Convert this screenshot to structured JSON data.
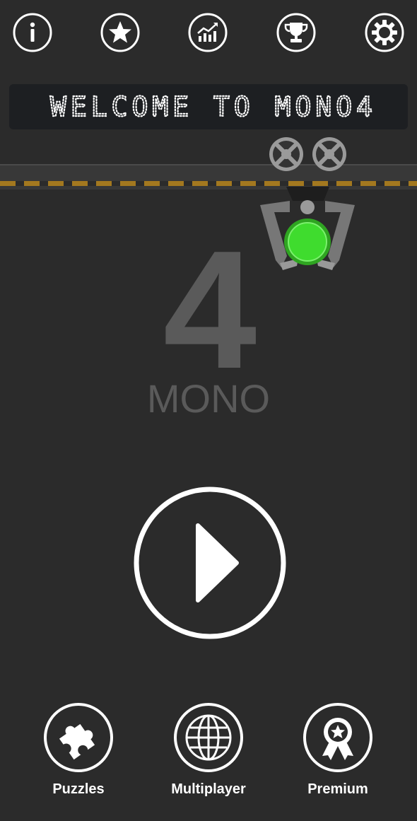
{
  "top_bar": {
    "icons": [
      "info-icon",
      "star-icon",
      "stats-chart-icon",
      "trophy-icon",
      "settings-gear-icon"
    ]
  },
  "banner": {
    "text": "WELCOME TO MONO4",
    "led_color": "#ffffff"
  },
  "logo": {
    "number": "4",
    "word": "MONO",
    "token_color": "#3fdc2e"
  },
  "play": {
    "icon": "play-icon"
  },
  "bottom_nav": {
    "puzzles_label": "Puzzles",
    "multiplayer_label": "Multiplayer",
    "premium_label": "Premium"
  },
  "colors": {
    "background": "#2b2b2b",
    "hazard_stripe": "#a3781f",
    "logo_gray": "#5a5a5a"
  }
}
